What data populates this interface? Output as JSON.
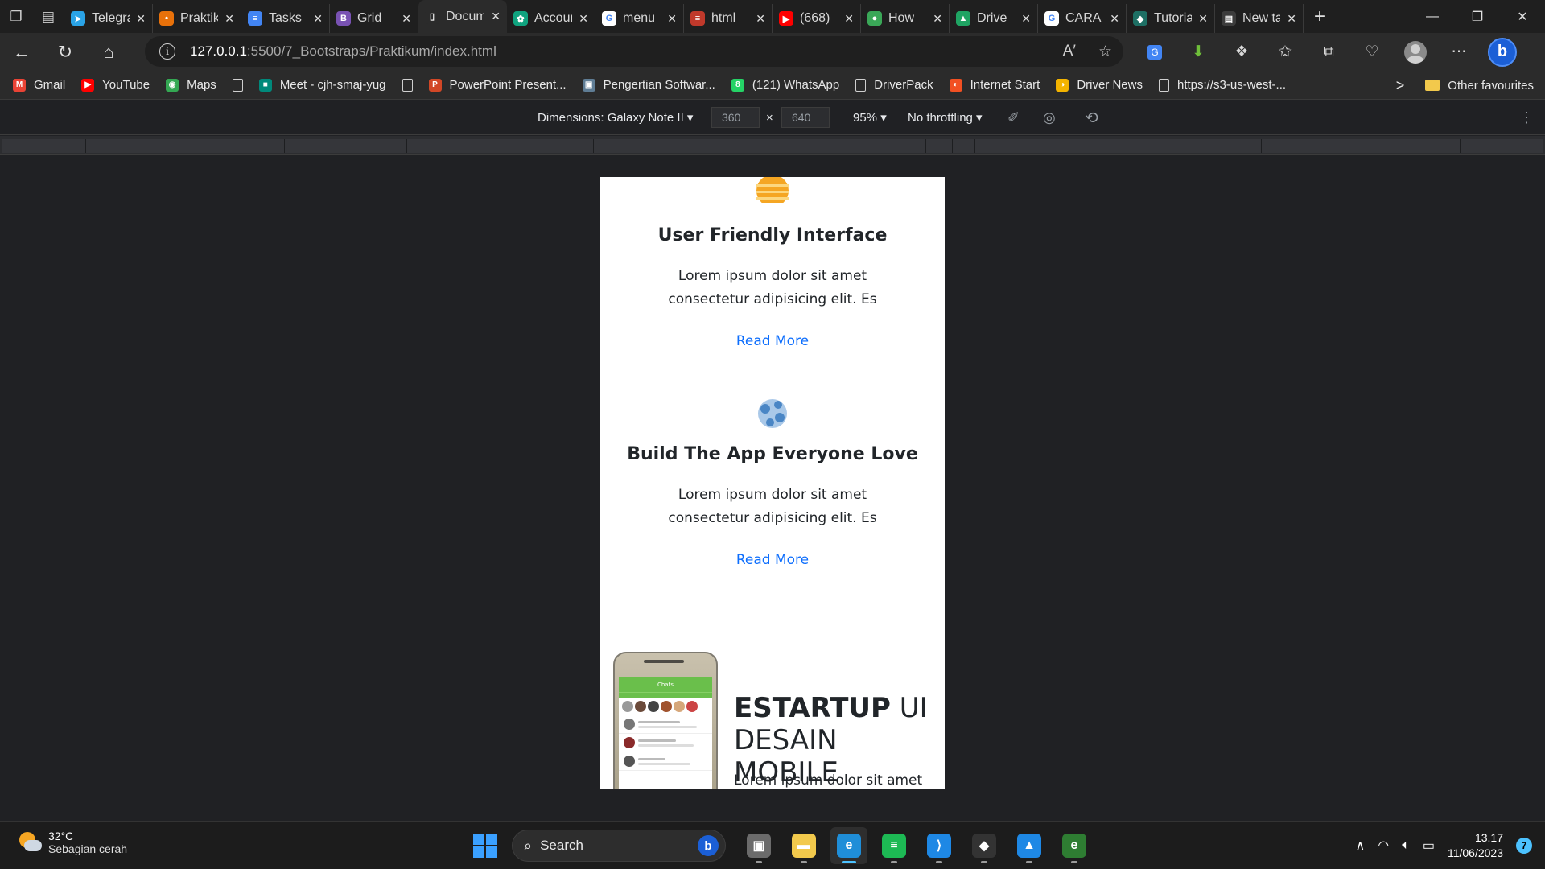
{
  "browser": {
    "tabs": [
      {
        "title": "Telegram",
        "color": "#2aa3e6",
        "glyph": "➤"
      },
      {
        "title": "Praktikum",
        "color": "#e8710a",
        "glyph": "•"
      },
      {
        "title": "Tasks",
        "color": "#4285f4",
        "glyph": "≡"
      },
      {
        "title": "Grid",
        "color": "#7952b3",
        "glyph": "B"
      },
      {
        "title": "Document",
        "color": "#2b2b2b",
        "glyph": "▯"
      },
      {
        "title": "Account",
        "color": "#10a37f",
        "glyph": "✿"
      },
      {
        "title": "menu",
        "color": "#ffffff",
        "glyph": "G"
      },
      {
        "title": "html",
        "color": "#c0392b",
        "glyph": "≡"
      },
      {
        "title": "(668)",
        "color": "#ff0000",
        "glyph": "▶"
      },
      {
        "title": "How",
        "color": "#3aa757",
        "glyph": "●"
      },
      {
        "title": "Drive",
        "color": "#1fa463",
        "glyph": "▲"
      },
      {
        "title": "CARA",
        "color": "#ffffff",
        "glyph": "G"
      },
      {
        "title": "Tutorial",
        "color": "#1e6f64",
        "glyph": "◆"
      },
      {
        "title": "New tab",
        "color": "#3c3c3c",
        "glyph": "▤"
      }
    ],
    "url_host": "127.0.0.1",
    "url_path": ":5500/7_Bootstraps/Praktikum/index.html",
    "bookmarks": [
      {
        "label": "Gmail",
        "color": "#ea4335",
        "glyph": "M"
      },
      {
        "label": "YouTube",
        "color": "#ff0000",
        "glyph": "▶"
      },
      {
        "label": "Maps",
        "color": "#34a853",
        "glyph": "◉"
      },
      {
        "label": "",
        "color": "",
        "glyph": "doc"
      },
      {
        "label": "Meet - cjh-smaj-yug",
        "color": "#00897b",
        "glyph": "■"
      },
      {
        "label": "",
        "color": "",
        "glyph": "doc"
      },
      {
        "label": "PowerPoint Present...",
        "color": "#d24726",
        "glyph": "P"
      },
      {
        "label": "Pengertian Softwar...",
        "color": "#5f7d95",
        "glyph": "▣"
      },
      {
        "label": "(121) WhatsApp",
        "color": "#25d366",
        "glyph": "8"
      },
      {
        "label": "DriverPack",
        "color": "",
        "glyph": "doc"
      },
      {
        "label": "Internet Start",
        "color": "#f25022",
        "glyph": "◐"
      },
      {
        "label": "Driver News",
        "color": "#f4b400",
        "glyph": "◑"
      },
      {
        "label": "https://s3-us-west-...",
        "color": "",
        "glyph": "doc"
      }
    ],
    "bookmarks_more": ">",
    "other_favourites": "Other favourites"
  },
  "devtools": {
    "device_label": "Dimensions: Galaxy Note II ▾",
    "width": "360",
    "times": "×",
    "height": "640",
    "zoom": "95% ▾",
    "throttling": "No throttling ▾"
  },
  "page": {
    "features": [
      {
        "title": "User Friendly Interface",
        "text": "Lorem ipsum dolor sit amet consectetur adipisicing elit. Es",
        "link": "Read More",
        "icon_color": "#f5a623"
      },
      {
        "title": "Build The App Everyone Love",
        "text": "Lorem ipsum dolor sit amet consectetur adipisicing elit. Es",
        "link": "Read More",
        "icon_color": "#5b9bd5"
      }
    ],
    "hero": {
      "title_bold": "ESTARTUP",
      "title_light_1": " UI",
      "title_light_2": "DESAIN MOBILE",
      "text": "Lorem ipsum dolor sit amet"
    },
    "phone": {
      "header": "Chats"
    }
  },
  "taskbar": {
    "temperature": "32°C",
    "weather": "Sebagian cerah",
    "search_placeholder": "Search",
    "time": "13.17",
    "date": "11/06/2023",
    "notifications": "7",
    "apps": [
      {
        "name": "task-view",
        "color": "#6b6b6b",
        "glyph": "▣",
        "active": false
      },
      {
        "name": "file-explorer",
        "color": "#f2c94c",
        "glyph": "▬",
        "active": false
      },
      {
        "name": "edge",
        "color": "#1f8ed8",
        "glyph": "e",
        "active": true
      },
      {
        "name": "spotify",
        "color": "#1db954",
        "glyph": "≡",
        "active": false
      },
      {
        "name": "vscode",
        "color": "#1e88e5",
        "glyph": "⟩",
        "active": false
      },
      {
        "name": "inkscape",
        "color": "#333333",
        "glyph": "◆",
        "active": false
      },
      {
        "name": "photos",
        "color": "#1e88e5",
        "glyph": "▲",
        "active": false
      },
      {
        "name": "edge-dev",
        "color": "#2e7d32",
        "glyph": "e",
        "active": false
      }
    ]
  }
}
